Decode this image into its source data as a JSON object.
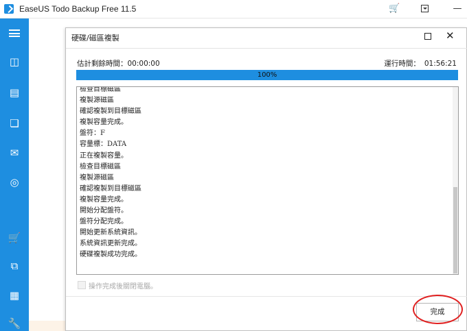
{
  "window": {
    "title": "EaseUS Todo Backup Free 11.5",
    "icons": [
      "cart-icon",
      "menu-dropdown-icon",
      "minimize-icon"
    ]
  },
  "sidebar": {
    "items": [
      {
        "name": "menu-icon"
      },
      {
        "name": "disk-backup-icon"
      },
      {
        "name": "system-backup-icon"
      },
      {
        "name": "file-backup-icon"
      },
      {
        "name": "mail-backup-icon"
      },
      {
        "name": "smart-backup-icon"
      },
      {
        "name": "cart-icon"
      },
      {
        "name": "clone-icon"
      },
      {
        "name": "apps-icon"
      },
      {
        "name": "tools-icon"
      }
    ]
  },
  "dialog": {
    "title": "硬碟/磁區複製",
    "estimated_label": "估計剩餘時間：",
    "estimated_value": "00:00:00",
    "elapsed_label": "運行時間：",
    "elapsed_value": "01:56:21",
    "progress": {
      "value": 100,
      "text": "100%",
      "fill_color": "#1e8ee0"
    },
    "log": [
      "檢查目標磁區",
      "複製源磁區",
      "確認複製到目標磁區",
      "複製容量完成。",
      "盤符：F",
      "容量標：DATA",
      "正在複製容量。",
      "檢查目標磁區",
      "複製源磁區",
      "確認複製到目標磁區",
      "複製容量完成。",
      "開始分配盤符。",
      "盤符分配完成。",
      "開始更新系統資訊。",
      "系統資訊更新完成。",
      "硬碟複製成功完成。"
    ],
    "shutdown_label": "操作完成後關閉電腦。",
    "finish_label": "完成",
    "accent_color": "#1e8ee0",
    "highlight_color": "#e02020"
  }
}
